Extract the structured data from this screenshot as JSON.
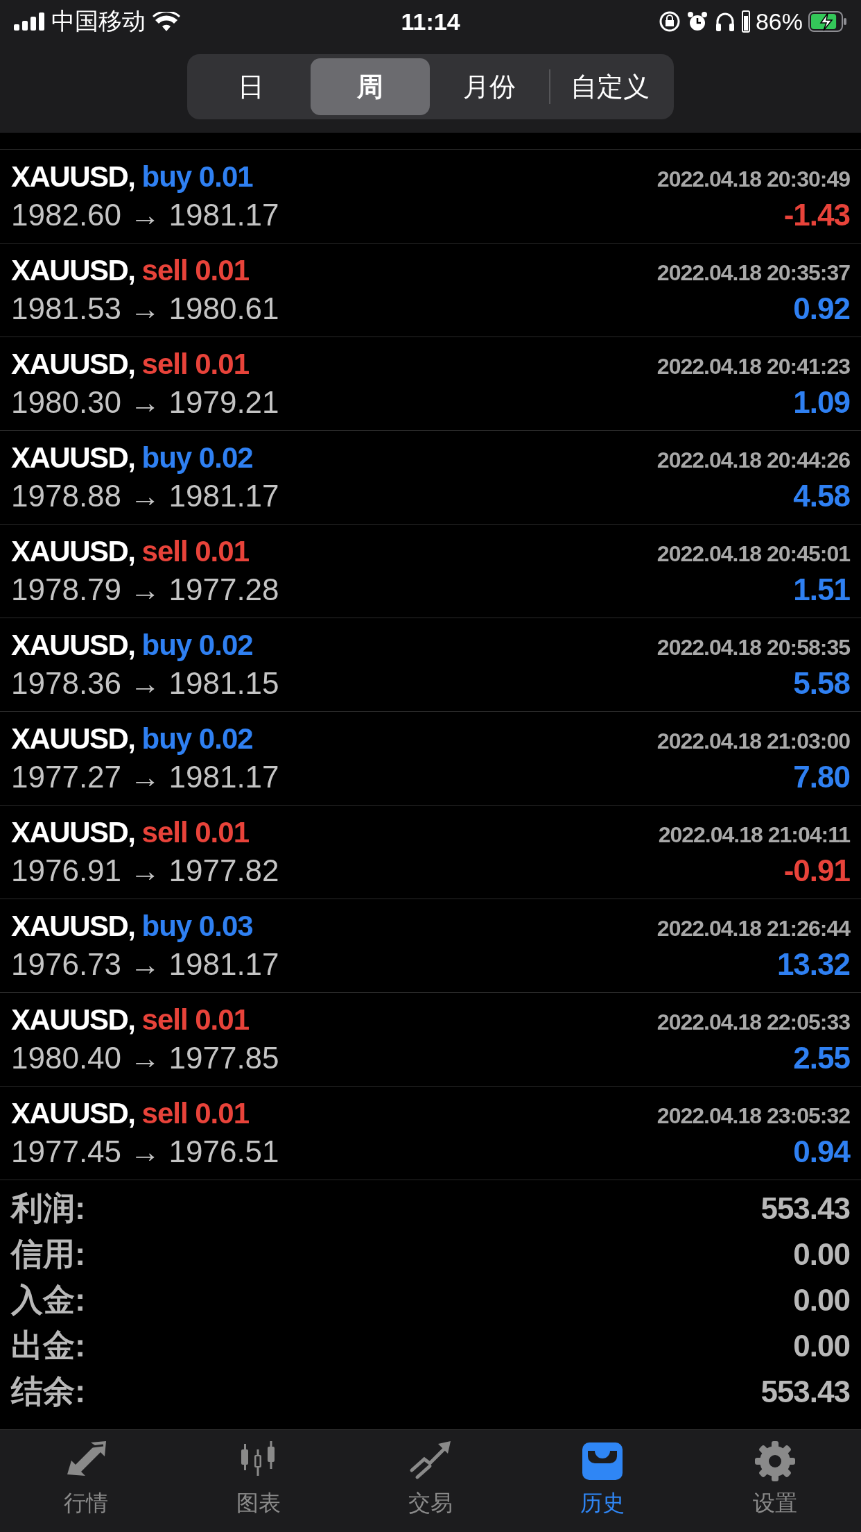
{
  "status_bar": {
    "carrier": "中国移动",
    "time": "11:14",
    "battery": "86%",
    "charging": true
  },
  "period_tabs": [
    {
      "label": "日",
      "selected": false
    },
    {
      "label": "周",
      "selected": true
    },
    {
      "label": "月份",
      "selected": false
    },
    {
      "label": "自定义",
      "selected": false
    }
  ],
  "deals": [
    {
      "title": "XAUUSD,",
      "kind": "buy",
      "order": "buy 0.01",
      "time": "2022.04.18 20:30:49",
      "prices": "1982.60 → 1981.17",
      "profit": "-1.43",
      "loss": true
    },
    {
      "title": "XAUUSD,",
      "kind": "sell",
      "order": "sell 0.01",
      "time": "2022.04.18 20:35:37",
      "prices": "1981.53 → 1980.61",
      "profit": "0.92",
      "loss": false
    },
    {
      "title": "XAUUSD,",
      "kind": "sell",
      "order": "sell 0.01",
      "time": "2022.04.18 20:41:23",
      "prices": "1980.30 → 1979.21",
      "profit": "1.09",
      "loss": false
    },
    {
      "title": "XAUUSD,",
      "kind": "buy",
      "order": "buy 0.02",
      "time": "2022.04.18 20:44:26",
      "prices": "1978.88 → 1981.17",
      "profit": "4.58",
      "loss": false
    },
    {
      "title": "XAUUSD,",
      "kind": "sell",
      "order": "sell 0.01",
      "time": "2022.04.18 20:45:01",
      "prices": "1978.79 → 1977.28",
      "profit": "1.51",
      "loss": false
    },
    {
      "title": "XAUUSD,",
      "kind": "buy",
      "order": "buy 0.02",
      "time": "2022.04.18 20:58:35",
      "prices": "1978.36 → 1981.15",
      "profit": "5.58",
      "loss": false
    },
    {
      "title": "XAUUSD,",
      "kind": "buy",
      "order": "buy 0.02",
      "time": "2022.04.18 21:03:00",
      "prices": "1977.27 → 1981.17",
      "profit": "7.80",
      "loss": false
    },
    {
      "title": "XAUUSD,",
      "kind": "sell",
      "order": "sell 0.01",
      "time": "2022.04.18 21:04:11",
      "prices": "1976.91 → 1977.82",
      "profit": "-0.91",
      "loss": true
    },
    {
      "title": "XAUUSD,",
      "kind": "buy",
      "order": "buy 0.03",
      "time": "2022.04.18 21:26:44",
      "prices": "1976.73 → 1981.17",
      "profit": "13.32",
      "loss": false
    },
    {
      "title": "XAUUSD,",
      "kind": "sell",
      "order": "sell 0.01",
      "time": "2022.04.18 22:05:33",
      "prices": "1980.40 → 1977.85",
      "profit": "2.55",
      "loss": false
    },
    {
      "title": "XAUUSD,",
      "kind": "sell",
      "order": "sell 0.01",
      "time": "2022.04.18 23:05:32",
      "prices": "1977.45 → 1976.51",
      "profit": "0.94",
      "loss": false
    }
  ],
  "summary": [
    {
      "label": "利润:",
      "value": "553.43"
    },
    {
      "label": "信用:",
      "value": "0.00"
    },
    {
      "label": "入金:",
      "value": "0.00"
    },
    {
      "label": "出金:",
      "value": "0.00"
    },
    {
      "label": "结余:",
      "value": "553.43"
    }
  ],
  "tab_bar": [
    {
      "label": "行情",
      "kind": "quotes",
      "selected": false
    },
    {
      "label": "图表",
      "kind": "chart",
      "selected": false
    },
    {
      "label": "交易",
      "kind": "trade",
      "selected": false
    },
    {
      "label": "历史",
      "kind": "history",
      "selected": true
    },
    {
      "label": "设置",
      "kind": "settings",
      "selected": false
    }
  ]
}
